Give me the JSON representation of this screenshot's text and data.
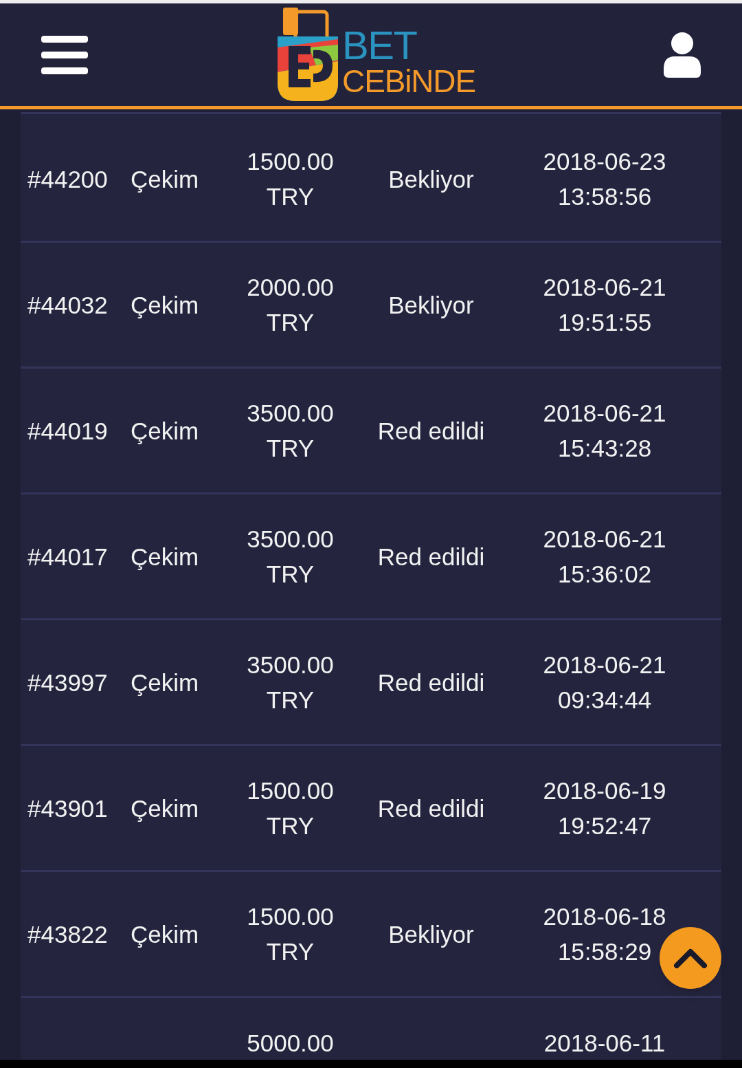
{
  "header": {
    "logo": {
      "line_1": "BET",
      "line_2": "CEBiNDE"
    }
  },
  "transactions": [
    {
      "id": "#44200",
      "type": "Çekim",
      "amount": "1500.00 TRY",
      "status": "Bekliyor",
      "date": "2018-06-23 13:58:56"
    },
    {
      "id": "#44032",
      "type": "Çekim",
      "amount": "2000.00 TRY",
      "status": "Bekliyor",
      "date": "2018-06-21 19:51:55"
    },
    {
      "id": "#44019",
      "type": "Çekim",
      "amount": "3500.00 TRY",
      "status": "Red edildi",
      "date": "2018-06-21 15:43:28"
    },
    {
      "id": "#44017",
      "type": "Çekim",
      "amount": "3500.00 TRY",
      "status": "Red edildi",
      "date": "2018-06-21 15:36:02"
    },
    {
      "id": "#43997",
      "type": "Çekim",
      "amount": "3500.00 TRY",
      "status": "Red edildi",
      "date": "2018-06-21 09:34:44"
    },
    {
      "id": "#43901",
      "type": "Çekim",
      "amount": "1500.00 TRY",
      "status": "Red edildi",
      "date": "2018-06-19 19:52:47"
    },
    {
      "id": "#43822",
      "type": "Çekim",
      "amount": "1500.00 TRY",
      "status": "Bekliyor",
      "date": "2018-06-18 15:58:29"
    }
  ],
  "partial_row": {
    "amount": "5000.00",
    "date": "2018-06-11"
  }
}
